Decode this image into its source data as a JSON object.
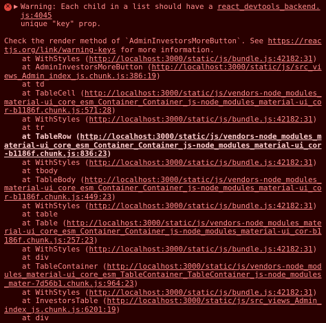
{
  "warning": {
    "head": "Warning: Each child in a list should have a ",
    "source": "react_devtools_backend.js:4045",
    "head2": "unique \"key\" prop."
  },
  "check": {
    "prefix": "Check the render method of `AdminInvestorsMoreButton`. See ",
    "link": "https://reactjs.org/link/warning-keys",
    "suffix": " for more information."
  },
  "stack": [
    {
      "pre": "    at WithStyles (",
      "url": "http://localhost:3000/static/js/bundle.js:42182:31",
      "post": ")",
      "bold": false
    },
    {
      "pre": "    at AdminInvestorsMoreButton (",
      "url": "http://localhost:3000/static/js/src_views_Admin_index_js.chunk.js:386:19",
      "post": ")",
      "bold": false
    },
    {
      "pre": "    at td",
      "url": "",
      "post": "",
      "bold": false
    },
    {
      "pre": "    at TableCell (",
      "url": "http://localhost:3000/static/js/vendors-node_modules_material-ui_core_esm_Container_Container_js-node_modules_material-ui_cor-b1186f.chunk.js:571:28",
      "post": ")",
      "bold": false
    },
    {
      "pre": "    at WithStyles (",
      "url": "http://localhost:3000/static/js/bundle.js:42182:31",
      "post": ")",
      "bold": false
    },
    {
      "pre": "    at tr",
      "url": "",
      "post": "",
      "bold": false
    },
    {
      "pre": "    at TableRow (",
      "url": "http://localhost:3000/static/js/vendors-node_modules_material-ui_core_esm_Container_Container_js-node_modules_material-ui_cor-b1186f.chunk.js:836:23",
      "post": ")",
      "bold": true
    },
    {
      "pre": "    at WithStyles (",
      "url": "http://localhost:3000/static/js/bundle.js:42182:31",
      "post": ")",
      "bold": false
    },
    {
      "pre": "    at tbody",
      "url": "",
      "post": "",
      "bold": false
    },
    {
      "pre": "    at TableBody (",
      "url": "http://localhost:3000/static/js/vendors-node_modules_material-ui_core_esm_Container_Container_js-node_modules_material-ui_cor-b1186f.chunk.js:449:23",
      "post": ")",
      "bold": false
    },
    {
      "pre": "    at WithStyles (",
      "url": "http://localhost:3000/static/js/bundle.js:42182:31",
      "post": ")",
      "bold": false
    },
    {
      "pre": "    at table",
      "url": "",
      "post": "",
      "bold": false
    },
    {
      "pre": "    at Table (",
      "url": "http://localhost:3000/static/js/vendors-node_modules_material-ui_core_esm_Container_Container_js-node_modules_material-ui_cor-b1186f.chunk.js:257:23",
      "post": ")",
      "bold": false
    },
    {
      "pre": "    at WithStyles (",
      "url": "http://localhost:3000/static/js/bundle.js:42182:31",
      "post": ")",
      "bold": false
    },
    {
      "pre": "    at div",
      "url": "",
      "post": "",
      "bold": false
    },
    {
      "pre": "    at TableContainer (",
      "url": "http://localhost:3000/static/js/vendors-node_modules_material-ui_core_esm_TableContainer_TableContainer_js-node_modules_mater-7d56b1.chunk.js:964:23",
      "post": ")",
      "bold": false
    },
    {
      "pre": "    at WithStyles (",
      "url": "http://localhost:3000/static/js/bundle.js:42182:31",
      "post": ")",
      "bold": false
    },
    {
      "pre": "    at InvestorsTable (",
      "url": "http://localhost:3000/static/js/src_views_Admin_index_js.chunk.js:6201:19",
      "post": ")",
      "bold": false
    },
    {
      "pre": "    at div",
      "url": "",
      "post": "",
      "bold": false
    }
  ],
  "icons": {
    "error": "error-circle-icon",
    "toggle": "disclosure-triangle-icon"
  },
  "colors": {
    "background": "#290000",
    "text": "#ff8a8a",
    "icon": "#e0443c"
  }
}
